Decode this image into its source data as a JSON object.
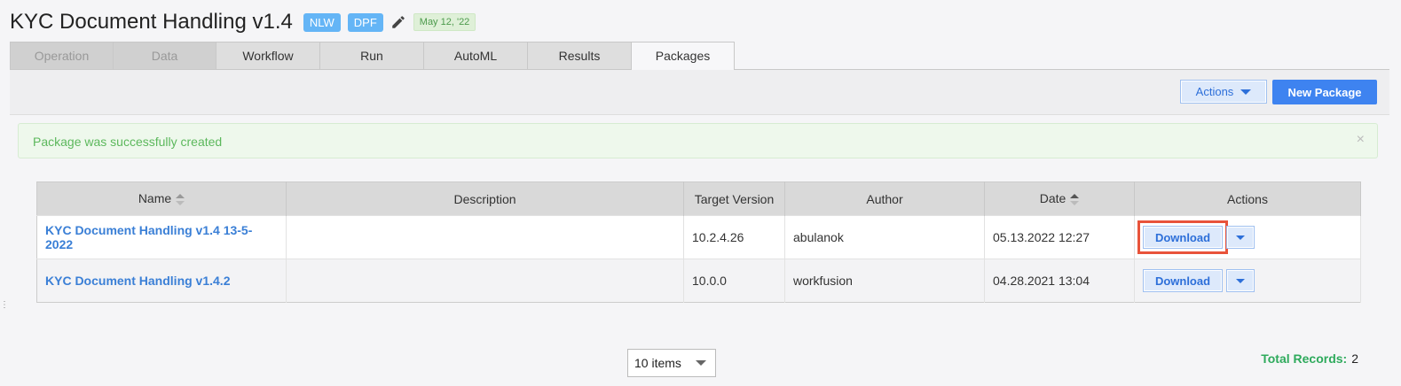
{
  "header": {
    "title": "KYC Document Handling v1.4",
    "tags": [
      "NLW",
      "DPF"
    ],
    "date_badge": "May 12, '22"
  },
  "tabs": [
    {
      "label": "Operation",
      "state": "disabled"
    },
    {
      "label": "Data",
      "state": "disabled"
    },
    {
      "label": "Workflow",
      "state": "normal"
    },
    {
      "label": "Run",
      "state": "normal"
    },
    {
      "label": "AutoML",
      "state": "normal"
    },
    {
      "label": "Results",
      "state": "normal"
    },
    {
      "label": "Packages",
      "state": "active"
    }
  ],
  "toolbar": {
    "actions_label": "Actions",
    "new_package_label": "New Package"
  },
  "alert": {
    "message": "Package was successfully created",
    "close_symbol": "×"
  },
  "table": {
    "columns": [
      "Name",
      "Description",
      "Target Version",
      "Author",
      "Date",
      "Actions"
    ],
    "rows": [
      {
        "name": "KYC Document Handling v1.4 13-5-2022",
        "description": "",
        "target_version": "10.2.4.26",
        "author": "abulanok",
        "date": "05.13.2022 12:27",
        "action_label": "Download"
      },
      {
        "name": "KYC Document Handling v1.4.2",
        "description": "",
        "target_version": "10.0.0",
        "author": "workfusion",
        "date": "04.28.2021 13:04",
        "action_label": "Download"
      }
    ]
  },
  "pager": {
    "page_size_label": "10 items"
  },
  "footer": {
    "total_label": "Total Records:",
    "total_value": "2"
  },
  "colors": {
    "accent": "#3e83f0",
    "success": "#5cb85c",
    "tag": "#64b5f6",
    "highlight": "#e8533a"
  }
}
